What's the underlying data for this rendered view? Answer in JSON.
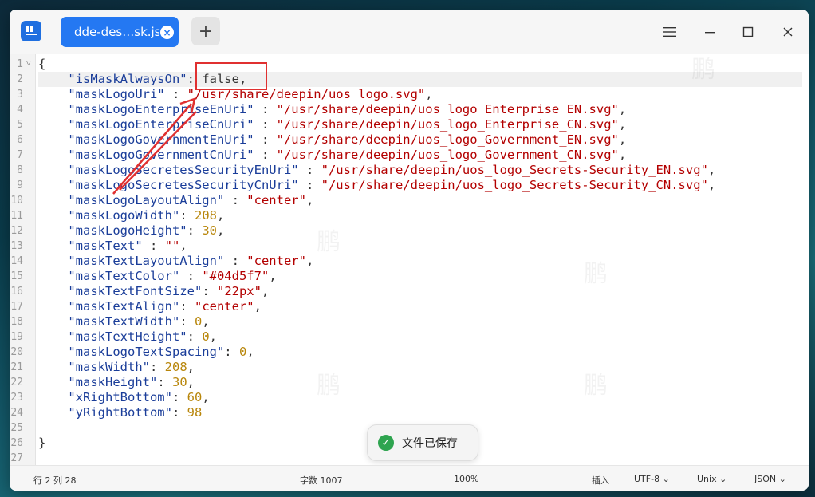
{
  "titlebar": {
    "app_icon": "deepin-editor-icon",
    "tab_label": "dde-des…sk.json",
    "tab_close": "×",
    "add_tab": "+",
    "menu_icon": "≡",
    "minimize_icon": "—",
    "maximize_icon": "□",
    "close_icon": "✕"
  },
  "editor": {
    "lines": [
      {
        "n": "1",
        "fold": true,
        "tokens": [
          {
            "t": "p",
            "v": "{"
          }
        ]
      },
      {
        "n": "2",
        "current": true,
        "tokens": [
          {
            "t": "k",
            "v": "    \"isMaskAlwaysOn\""
          },
          {
            "t": "p",
            "v": ": "
          },
          {
            "t": "p",
            "v": "false"
          },
          {
            "t": "p",
            "v": ","
          }
        ]
      },
      {
        "n": "3",
        "tokens": [
          {
            "t": "k",
            "v": "    \"maskLogoUri\""
          },
          {
            "t": "p",
            "v": " : "
          },
          {
            "t": "s",
            "v": "\"/usr/share/deepin/uos_logo.svg\""
          },
          {
            "t": "p",
            "v": ","
          }
        ]
      },
      {
        "n": "4",
        "tokens": [
          {
            "t": "k",
            "v": "    \"maskLogoEnterpriseEnUri\""
          },
          {
            "t": "p",
            "v": " : "
          },
          {
            "t": "s",
            "v": "\"/usr/share/deepin/uos_logo_Enterprise_EN.svg\""
          },
          {
            "t": "p",
            "v": ","
          }
        ]
      },
      {
        "n": "5",
        "tokens": [
          {
            "t": "k",
            "v": "    \"maskLogoEnterpriseCnUri\""
          },
          {
            "t": "p",
            "v": " : "
          },
          {
            "t": "s",
            "v": "\"/usr/share/deepin/uos_logo_Enterprise_CN.svg\""
          },
          {
            "t": "p",
            "v": ","
          }
        ]
      },
      {
        "n": "6",
        "tokens": [
          {
            "t": "k",
            "v": "    \"maskLogoGovernmentEnUri\""
          },
          {
            "t": "p",
            "v": " : "
          },
          {
            "t": "s",
            "v": "\"/usr/share/deepin/uos_logo_Government_EN.svg\""
          },
          {
            "t": "p",
            "v": ","
          }
        ]
      },
      {
        "n": "7",
        "tokens": [
          {
            "t": "k",
            "v": "    \"maskLogoGovernmentCnUri\""
          },
          {
            "t": "p",
            "v": " : "
          },
          {
            "t": "s",
            "v": "\"/usr/share/deepin/uos_logo_Government_CN.svg\""
          },
          {
            "t": "p",
            "v": ","
          }
        ]
      },
      {
        "n": "8",
        "tokens": [
          {
            "t": "k",
            "v": "    \"maskLogoSecretesSecurityEnUri\""
          },
          {
            "t": "p",
            "v": " : "
          },
          {
            "t": "s",
            "v": "\"/usr/share/deepin/uos_logo_Secrets-Security_EN.svg\""
          },
          {
            "t": "p",
            "v": ","
          }
        ]
      },
      {
        "n": "9",
        "tokens": [
          {
            "t": "k",
            "v": "    \"maskLogoSecretesSecurityCnUri\""
          },
          {
            "t": "p",
            "v": " : "
          },
          {
            "t": "s",
            "v": "\"/usr/share/deepin/uos_logo_Secrets-Security_CN.svg\""
          },
          {
            "t": "p",
            "v": ","
          }
        ]
      },
      {
        "n": "10",
        "tokens": [
          {
            "t": "k",
            "v": "    \"maskLogoLayoutAlign\""
          },
          {
            "t": "p",
            "v": " : "
          },
          {
            "t": "s",
            "v": "\"center\""
          },
          {
            "t": "p",
            "v": ","
          }
        ]
      },
      {
        "n": "11",
        "tokens": [
          {
            "t": "k",
            "v": "    \"maskLogoWidth\""
          },
          {
            "t": "p",
            "v": ": "
          },
          {
            "t": "n",
            "v": "208"
          },
          {
            "t": "p",
            "v": ","
          }
        ]
      },
      {
        "n": "12",
        "tokens": [
          {
            "t": "k",
            "v": "    \"maskLogoHeight\""
          },
          {
            "t": "p",
            "v": ": "
          },
          {
            "t": "n",
            "v": "30"
          },
          {
            "t": "p",
            "v": ","
          }
        ]
      },
      {
        "n": "13",
        "tokens": [
          {
            "t": "k",
            "v": "    \"maskText\""
          },
          {
            "t": "p",
            "v": " : "
          },
          {
            "t": "s",
            "v": "\"\""
          },
          {
            "t": "p",
            "v": ","
          }
        ]
      },
      {
        "n": "14",
        "tokens": [
          {
            "t": "k",
            "v": "    \"maskTextLayoutAlign\""
          },
          {
            "t": "p",
            "v": " : "
          },
          {
            "t": "s",
            "v": "\"center\""
          },
          {
            "t": "p",
            "v": ","
          }
        ]
      },
      {
        "n": "15",
        "tokens": [
          {
            "t": "k",
            "v": "    \"maskTextColor\""
          },
          {
            "t": "p",
            "v": " : "
          },
          {
            "t": "s",
            "v": "\"#04d5f7\""
          },
          {
            "t": "p",
            "v": ","
          }
        ]
      },
      {
        "n": "16",
        "tokens": [
          {
            "t": "k",
            "v": "    \"maskTextFontSize\""
          },
          {
            "t": "p",
            "v": ": "
          },
          {
            "t": "s",
            "v": "\"22px\""
          },
          {
            "t": "p",
            "v": ","
          }
        ]
      },
      {
        "n": "17",
        "tokens": [
          {
            "t": "k",
            "v": "    \"maskTextAlign\""
          },
          {
            "t": "p",
            "v": ": "
          },
          {
            "t": "s",
            "v": "\"center\""
          },
          {
            "t": "p",
            "v": ","
          }
        ]
      },
      {
        "n": "18",
        "tokens": [
          {
            "t": "k",
            "v": "    \"maskTextWidth\""
          },
          {
            "t": "p",
            "v": ": "
          },
          {
            "t": "n",
            "v": "0"
          },
          {
            "t": "p",
            "v": ","
          }
        ]
      },
      {
        "n": "19",
        "tokens": [
          {
            "t": "k",
            "v": "    \"maskTextHeight\""
          },
          {
            "t": "p",
            "v": ": "
          },
          {
            "t": "n",
            "v": "0"
          },
          {
            "t": "p",
            "v": ","
          }
        ]
      },
      {
        "n": "20",
        "tokens": [
          {
            "t": "k",
            "v": "    \"maskLogoTextSpacing\""
          },
          {
            "t": "p",
            "v": ": "
          },
          {
            "t": "n",
            "v": "0"
          },
          {
            "t": "p",
            "v": ","
          }
        ]
      },
      {
        "n": "21",
        "tokens": [
          {
            "t": "k",
            "v": "    \"maskWidth\""
          },
          {
            "t": "p",
            "v": ": "
          },
          {
            "t": "n",
            "v": "208"
          },
          {
            "t": "p",
            "v": ","
          }
        ]
      },
      {
        "n": "22",
        "tokens": [
          {
            "t": "k",
            "v": "    \"maskHeight\""
          },
          {
            "t": "p",
            "v": ": "
          },
          {
            "t": "n",
            "v": "30"
          },
          {
            "t": "p",
            "v": ","
          }
        ]
      },
      {
        "n": "23",
        "tokens": [
          {
            "t": "k",
            "v": "    \"xRightBottom\""
          },
          {
            "t": "p",
            "v": ": "
          },
          {
            "t": "n",
            "v": "60"
          },
          {
            "t": "p",
            "v": ","
          }
        ]
      },
      {
        "n": "24",
        "tokens": [
          {
            "t": "k",
            "v": "    \"yRightBottom\""
          },
          {
            "t": "p",
            "v": ": "
          },
          {
            "t": "n",
            "v": "98"
          }
        ]
      },
      {
        "n": "25",
        "tokens": []
      },
      {
        "n": "26",
        "tokens": [
          {
            "t": "p",
            "v": "}"
          }
        ]
      },
      {
        "n": "27",
        "tokens": []
      }
    ]
  },
  "toast": {
    "text": "文件已保存",
    "icon": "check-circle-icon"
  },
  "statusbar": {
    "position": "行 2  列 28",
    "char_count": "字数 1007",
    "zoom": "100%",
    "insert_mode": "插入",
    "encoding": "UTF-8",
    "line_ending": "Unix",
    "syntax": "JSON"
  },
  "watermark": "鹏"
}
